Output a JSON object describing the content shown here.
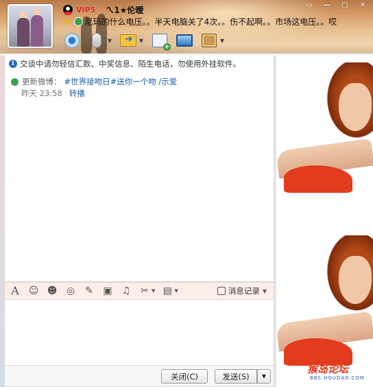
{
  "header": {
    "vip_badge": "VIP5",
    "nickname": "ㄟ1★伦暧",
    "signature": "尼玛的什么电压。。半天电脑关了4次。。伤不起啊。。市场这电压。。哎"
  },
  "toolbar": {
    "icons": [
      "video-call-icon",
      "voice-call-icon",
      "send-file-icon",
      "create-group-chat-icon",
      "remote-assist-icon",
      "app-box-icon"
    ]
  },
  "window_controls": [
    "skin-icon",
    "minimize-icon",
    "maximize-icon",
    "close-icon"
  ],
  "chat": {
    "notice": "交谈中请勿轻信汇款、中奖信息、陌生电话，勿使用外挂软件。",
    "feed": {
      "label": "更新微博：",
      "topic": "#世界接吻日#送你一个吻 /示爱",
      "time": "昨天 23:58",
      "forward": "转播"
    }
  },
  "input_toolbar": {
    "icons": [
      "font-icon",
      "emoji-icon",
      "magic-face-icon",
      "shake-icon",
      "doodle-icon",
      "image-icon",
      "music-icon",
      "screenshot-icon",
      "more-icon"
    ],
    "font_glyph": "A",
    "history_label": "消息记录"
  },
  "bottom": {
    "close_label": "关闭(C)",
    "send_label": "发送(S)",
    "send_menu_glyph": "▼"
  },
  "side_panel": {
    "watermark": "猴岛论坛",
    "watermark_sub": "BBS.HOUDAO.COM"
  },
  "colors": {
    "link": "#1e5fa8",
    "vip": "#d4241b",
    "watermark": "#e0391a"
  }
}
